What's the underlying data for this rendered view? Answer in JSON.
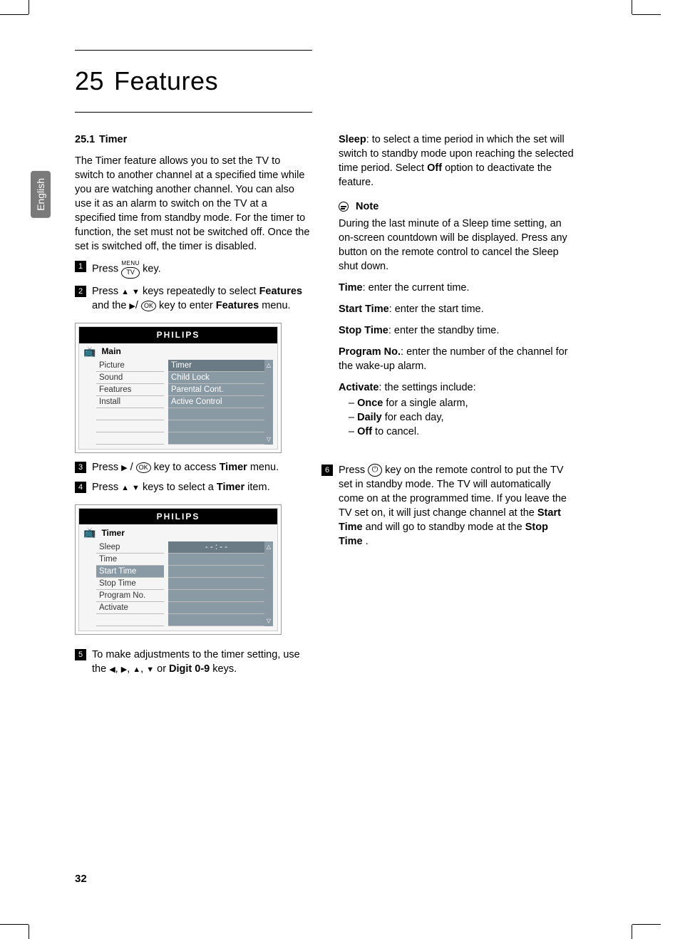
{
  "side_tab": "English",
  "chapter": {
    "number": "25",
    "title": "Features"
  },
  "section": {
    "number": "25.1",
    "title": "Timer"
  },
  "intro": "The Timer feature allows you to set the TV to switch to another channel at a specified time while you are watching another channel. You can also use it as an alarm to switch on the TV at a specified time from standby mode. For the timer to function, the set must not be switched off. Once the set is switched off, the timer is disabled.",
  "steps": {
    "s1_a": "Press ",
    "s1_b": " key.",
    "s2_a": "Press ",
    "s2_b": " keys repeatedly to select ",
    "s2_features": "Features",
    "s2_c": " and the ",
    "s2_d": " key to enter ",
    "s2_e": " menu.",
    "s3_a": "Press ",
    "s3_b": " key to access ",
    "s3_timer": "Timer",
    "s3_c": " menu.",
    "s4_a": "Press ",
    "s4_b": " keys to select a ",
    "s4_timer": "Timer",
    "s4_c": " item.",
    "s5_a": "To make adjustments to the timer setting, use the ",
    "s5_b": " or ",
    "s5_digit": "Digit 0-9",
    "s5_c": " keys.",
    "s6_a": "Press ",
    "s6_b": " key on the remote control to put the TV set in standby mode. The TV will automatically come on at the programmed time. If you leave the TV set on, it will just change channel at the ",
    "s6_start": "Start Time",
    "s6_c": " and will go to standby mode at the ",
    "s6_stop": "Stop Time",
    "s6_d": "."
  },
  "menu_key": {
    "label": "MENU",
    "btn": "TV"
  },
  "ok_label": "OK",
  "osd1": {
    "brand": "PHILIPS",
    "title": "Main",
    "left": [
      "Picture",
      "Sound",
      "Features",
      "Install"
    ],
    "right": [
      "Timer",
      "Child Lock",
      "Parental Cont.",
      "Active Control"
    ]
  },
  "osd2": {
    "brand": "PHILIPS",
    "title": "Timer",
    "left": [
      "Sleep",
      "Time",
      "Start Time",
      "Stop Time",
      "Program No.",
      "Activate"
    ],
    "right_value": "- - : - -"
  },
  "defs": {
    "sleep": {
      "label": "Sleep",
      "text": ": to select a time period in which the set will switch to standby mode upon reaching the selected time period. Select ",
      "off": "Off",
      "text2": " option to deactivate the feature."
    },
    "note_label": "Note",
    "note_body": "During the last minute of a Sleep time setting, an on-screen countdown will be displayed. Press any button on the remote control to cancel the Sleep shut down.",
    "time": {
      "label": "Time",
      "text": ": enter the current time."
    },
    "start": {
      "label": "Start Time",
      "text": ": enter the start time."
    },
    "stop": {
      "label": "Stop Time",
      "text": ": enter the standby time."
    },
    "prog": {
      "label": "Program No.",
      "text": ": enter the number of the channel for the wake-up alarm."
    },
    "activate": {
      "label": "Activate",
      "text": ": the settings include:",
      "items": [
        {
          "b": "Once",
          "t": " for a single alarm,"
        },
        {
          "b": "Daily",
          "t": " for each day,"
        },
        {
          "b": "Off",
          "t": " to cancel."
        }
      ]
    }
  },
  "page_number": "32"
}
